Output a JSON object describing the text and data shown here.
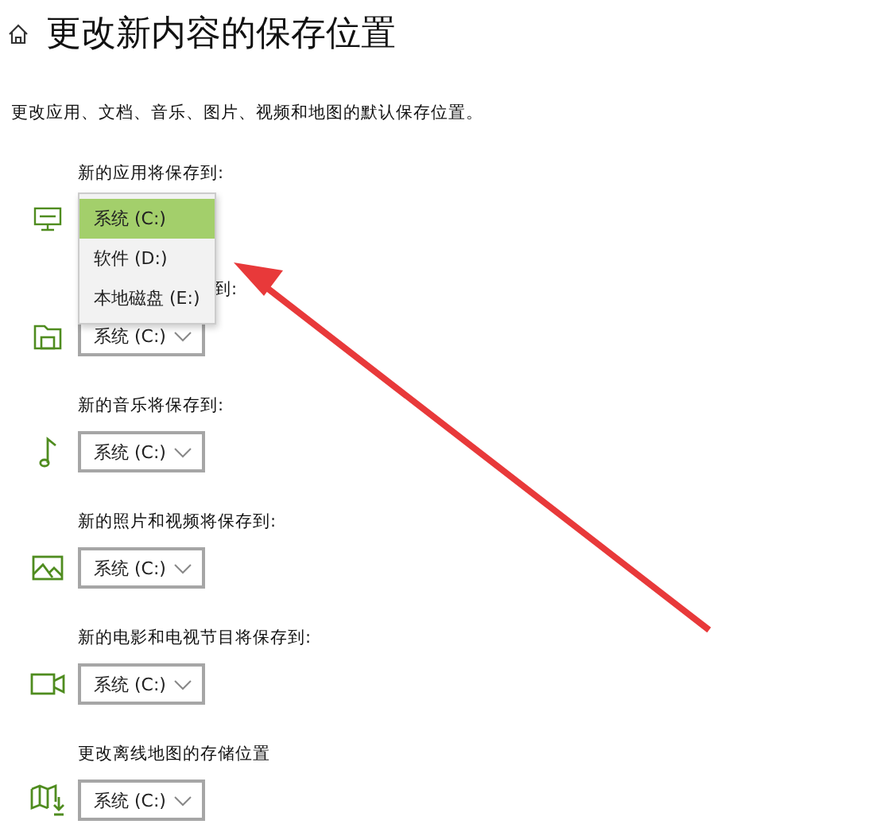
{
  "header": {
    "title": "更改新内容的保存位置"
  },
  "description": "更改应用、文档、音乐、图片、视频和地图的默认保存位置。",
  "rows": [
    {
      "kind": "open",
      "label": "新的应用将保存到:",
      "menu": [
        {
          "label": "系统 (C:)",
          "selected": true
        },
        {
          "label": "软件 (D:)",
          "selected": false
        },
        {
          "label": "本地磁盘 (E:)",
          "selected": false
        }
      ]
    },
    {
      "kind": "covered",
      "label": "到:",
      "value": "系统 (C:)"
    },
    {
      "kind": "plain",
      "label": "新的音乐将保存到:",
      "value": "系统 (C:)"
    },
    {
      "kind": "plain",
      "label": "新的照片和视频将保存到:",
      "value": "系统 (C:)"
    },
    {
      "kind": "plain",
      "label": "新的电影和电视节目将保存到:",
      "value": "系统 (C:)"
    },
    {
      "kind": "plain",
      "label": "更改离线地图的存储位置",
      "value": "系统 (C:)"
    }
  ]
}
